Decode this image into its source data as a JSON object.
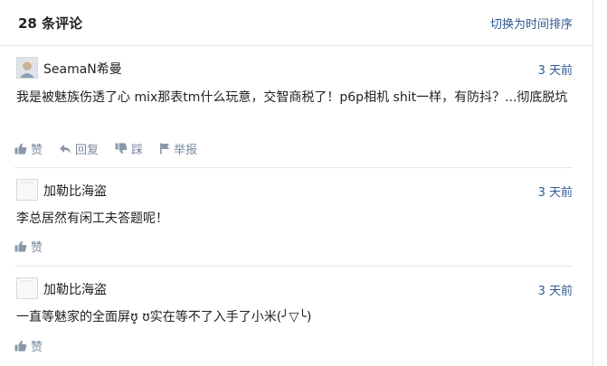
{
  "header": {
    "comment_count": "28 条评论",
    "sort_toggle": "切换为时间排序"
  },
  "comments": [
    {
      "user": "SeamaN希曼",
      "avatar_icon": "user-photo-icon",
      "time": "3 天前",
      "text": "我是被魅族伤透了心  mix那表tm什么玩意，交智商税了！p6p相机 shit一样，有防抖？...彻底脱坑",
      "actions": {
        "like": "赞",
        "reply": "回复",
        "dislike": "踩",
        "report": "举报"
      }
    },
    {
      "user": "加勒比海盗",
      "avatar_icon": "default-avatar-icon",
      "time": "3 天前",
      "text": "李总居然有闲工夫答题呢！",
      "actions": {
        "like": "赞"
      }
    },
    {
      "user": "加勒比海盗",
      "avatar_icon": "default-avatar-icon",
      "time": "3 天前",
      "text": "一直等魅家的全面屏ʊ̥ ʊ实在等不了入手了小米(╯▽╰)",
      "actions": {
        "like": "赞"
      }
    }
  ],
  "colors": {
    "link": "#2e5b92",
    "action": "#7a8aa0",
    "divider": "#e8e8e8"
  }
}
